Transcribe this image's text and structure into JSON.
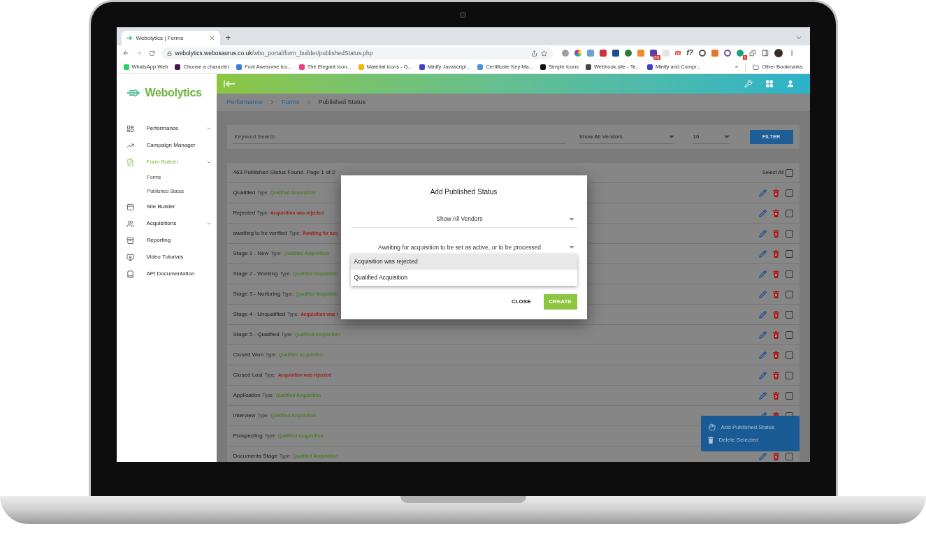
{
  "browser": {
    "tab": {
      "title": "Webolytics | Forms"
    },
    "new_tab": "+",
    "url": {
      "host": "webolytics.webosaurus.co.uk",
      "path": "/wbo_portal/form_builder/publishedStatus.php"
    },
    "extensions": [
      {
        "kind": "dot",
        "color": "#9e9e9e"
      },
      {
        "kind": "wheel"
      },
      {
        "kind": "tile",
        "color": "#6e9fd8"
      },
      {
        "kind": "tile",
        "color": "#d32f3f"
      },
      {
        "kind": "tile",
        "color": "#1e4f8c"
      },
      {
        "kind": "dot",
        "color": "#2e7d32"
      },
      {
        "kind": "tile",
        "color": "#f08a24"
      },
      {
        "kind": "tile",
        "color": "#5a3fb0",
        "badge": "20"
      },
      {
        "kind": "tile",
        "color": "#e4e4e4"
      },
      {
        "kind": "glyph",
        "color": "#e02020",
        "glyph": "m"
      },
      {
        "kind": "glyph",
        "color": "#333333",
        "glyph": "f?"
      },
      {
        "kind": "ring",
        "color": "#555555"
      },
      {
        "kind": "tile",
        "color": "#e8762b"
      },
      {
        "kind": "ring",
        "color": "#6b4fa0"
      },
      {
        "kind": "dot",
        "color": "#1aa37a",
        "badge": "1"
      }
    ],
    "bookmarks": [
      {
        "label": "WhatsApp Web",
        "color": "#25d366"
      },
      {
        "label": "Choose a character",
        "color": "#4a154b"
      },
      {
        "label": "Font Awesome Ico...",
        "color": "#3b7ddd"
      },
      {
        "label": "The Elegant Icon...",
        "color": "#e83e8c"
      },
      {
        "label": "Material icons - G...",
        "color": "#f4b400"
      },
      {
        "label": "Minify Javascript...",
        "color": "#3f3fd0"
      },
      {
        "label": "Certificate Key Ma...",
        "color": "#4a90e2"
      },
      {
        "label": "Simple Icons",
        "color": "#111111"
      },
      {
        "label": "Webhook.site - Te...",
        "color": "#444444"
      },
      {
        "label": "Minify and Compr...",
        "color": "#3f3fd0"
      }
    ],
    "more_bookmarks": "»",
    "other_bookmarks": "Other Bookmarks"
  },
  "app": {
    "logo": "Webolytics",
    "sidebar": [
      {
        "label": "Performance",
        "selected": false,
        "expandable": true
      },
      {
        "label": "Campaign Manager",
        "selected": false,
        "expandable": false
      },
      {
        "label": "Form Builder",
        "selected": true,
        "expandable": true,
        "children": [
          {
            "label": "Forms",
            "selected": false
          },
          {
            "label": "Published Status",
            "selected": false
          }
        ]
      },
      {
        "label": "Site Builder",
        "selected": false,
        "expandable": false
      },
      {
        "label": "Acquisitions",
        "selected": false,
        "expandable": true
      },
      {
        "label": "Reporting",
        "selected": false,
        "expandable": false
      },
      {
        "label": "Video Tutorials",
        "selected": false,
        "expandable": false
      },
      {
        "label": "API Documentation",
        "selected": false,
        "expandable": false
      }
    ],
    "breadcrumb": [
      {
        "label": "Performance",
        "link": true
      },
      {
        "label": "Forms",
        "link": true
      },
      {
        "label": "Published Status",
        "link": false
      }
    ],
    "filter": {
      "placeholder": "Keyword Search",
      "vendor": "Show All Vendors",
      "per_page": "16",
      "button": "FILTER"
    },
    "list": {
      "summary": "463 Published Status Found. Page 1 of 2",
      "select_all": {
        "label": "Select All",
        "checked": false
      },
      "rows": [
        {
          "name": "Qualified",
          "type_label": "Type:",
          "type": "Qualified Acquisition",
          "color": "#4f7d2a",
          "checked": false
        },
        {
          "name": "Rejected",
          "type_label": "Type:",
          "type": "Acquisition was rejected",
          "color": "#a02020",
          "checked": false
        },
        {
          "name": "awaiting to be verified",
          "type_label": "Type:",
          "type": "Awaiting for acq",
          "color": "#a02020",
          "checked": false
        },
        {
          "name": "Stage 1 - New",
          "type_label": "Type:",
          "type": "Qualified Acquisition",
          "color": "#4f7d2a",
          "checked": false
        },
        {
          "name": "Stage 2 - Working",
          "type_label": "Type:",
          "type": "Qualified Acquisition",
          "color": "#4f7d2a",
          "checked": false
        },
        {
          "name": "Stage 3 - Nurturing",
          "type_label": "Type:",
          "type": "Qualified Acquisitio",
          "color": "#4f7d2a",
          "checked": false
        },
        {
          "name": "Stage 4 - Unqualified",
          "type_label": "Type:",
          "type": "Acquisition was r",
          "color": "#a02020",
          "checked": false
        },
        {
          "name": "Stage 5 - Qualified",
          "type_label": "Type:",
          "type": "Qualified Acquisition",
          "color": "#4f7d2a",
          "checked": false
        },
        {
          "name": "Closed Won",
          "type_label": "Type:",
          "type": "Qualified Acquisition",
          "color": "#4f7d2a",
          "checked": false
        },
        {
          "name": "Closed Lost",
          "type_label": "Type:",
          "type": "Acquisition was rejected",
          "color": "#a02020",
          "checked": false
        },
        {
          "name": "Application",
          "type_label": "Type:",
          "type": "Qualified Acquisition",
          "color": "#4f7d2a",
          "checked": false
        },
        {
          "name": "Interview",
          "type_label": "Type:",
          "type": "Qualified Acquisition",
          "color": "#4f7d2a",
          "checked": false
        },
        {
          "name": "Prospecting",
          "type_label": "Type:",
          "type": "Qualified Acquisition",
          "color": "#4f7d2a"
        },
        {
          "name": "Documents Stage",
          "type_label": "Type:",
          "type": "Qualified Acquisition",
          "color": "#4f7d2a",
          "checked": false
        }
      ]
    },
    "modal": {
      "title": "Add Published Status",
      "selects": [
        {
          "value": "Show All Vendors"
        },
        {
          "value": "Awaiting for acquisition to be set as active, or to be processed"
        }
      ],
      "options": [
        {
          "label": "Acquisition was rejected",
          "selected": true
        },
        {
          "label": "Qualified Acquisition",
          "selected": false
        }
      ],
      "close": "CLOSE",
      "create": "CREATE"
    },
    "speed_dial": [
      {
        "label": "Add Published Status"
      },
      {
        "label": "Delete Selected"
      }
    ]
  }
}
